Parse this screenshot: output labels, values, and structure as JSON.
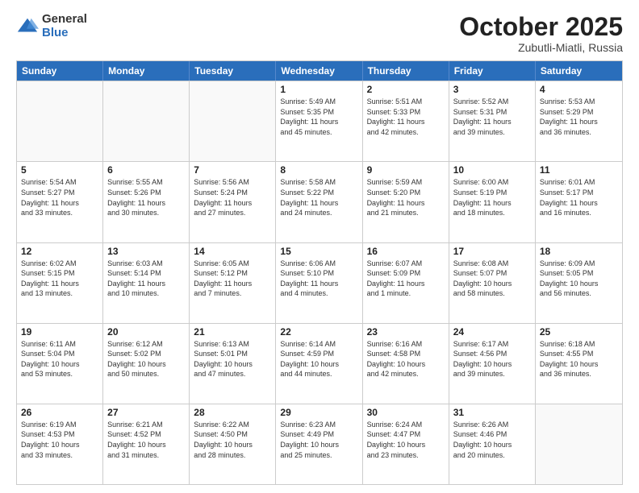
{
  "logo": {
    "general": "General",
    "blue": "Blue"
  },
  "title": "October 2025",
  "location": "Zubutli-Miatli, Russia",
  "weekdays": [
    "Sunday",
    "Monday",
    "Tuesday",
    "Wednesday",
    "Thursday",
    "Friday",
    "Saturday"
  ],
  "rows": [
    [
      {
        "day": "",
        "info": ""
      },
      {
        "day": "",
        "info": ""
      },
      {
        "day": "",
        "info": ""
      },
      {
        "day": "1",
        "info": "Sunrise: 5:49 AM\nSunset: 5:35 PM\nDaylight: 11 hours\nand 45 minutes."
      },
      {
        "day": "2",
        "info": "Sunrise: 5:51 AM\nSunset: 5:33 PM\nDaylight: 11 hours\nand 42 minutes."
      },
      {
        "day": "3",
        "info": "Sunrise: 5:52 AM\nSunset: 5:31 PM\nDaylight: 11 hours\nand 39 minutes."
      },
      {
        "day": "4",
        "info": "Sunrise: 5:53 AM\nSunset: 5:29 PM\nDaylight: 11 hours\nand 36 minutes."
      }
    ],
    [
      {
        "day": "5",
        "info": "Sunrise: 5:54 AM\nSunset: 5:27 PM\nDaylight: 11 hours\nand 33 minutes."
      },
      {
        "day": "6",
        "info": "Sunrise: 5:55 AM\nSunset: 5:26 PM\nDaylight: 11 hours\nand 30 minutes."
      },
      {
        "day": "7",
        "info": "Sunrise: 5:56 AM\nSunset: 5:24 PM\nDaylight: 11 hours\nand 27 minutes."
      },
      {
        "day": "8",
        "info": "Sunrise: 5:58 AM\nSunset: 5:22 PM\nDaylight: 11 hours\nand 24 minutes."
      },
      {
        "day": "9",
        "info": "Sunrise: 5:59 AM\nSunset: 5:20 PM\nDaylight: 11 hours\nand 21 minutes."
      },
      {
        "day": "10",
        "info": "Sunrise: 6:00 AM\nSunset: 5:19 PM\nDaylight: 11 hours\nand 18 minutes."
      },
      {
        "day": "11",
        "info": "Sunrise: 6:01 AM\nSunset: 5:17 PM\nDaylight: 11 hours\nand 16 minutes."
      }
    ],
    [
      {
        "day": "12",
        "info": "Sunrise: 6:02 AM\nSunset: 5:15 PM\nDaylight: 11 hours\nand 13 minutes."
      },
      {
        "day": "13",
        "info": "Sunrise: 6:03 AM\nSunset: 5:14 PM\nDaylight: 11 hours\nand 10 minutes."
      },
      {
        "day": "14",
        "info": "Sunrise: 6:05 AM\nSunset: 5:12 PM\nDaylight: 11 hours\nand 7 minutes."
      },
      {
        "day": "15",
        "info": "Sunrise: 6:06 AM\nSunset: 5:10 PM\nDaylight: 11 hours\nand 4 minutes."
      },
      {
        "day": "16",
        "info": "Sunrise: 6:07 AM\nSunset: 5:09 PM\nDaylight: 11 hours\nand 1 minute."
      },
      {
        "day": "17",
        "info": "Sunrise: 6:08 AM\nSunset: 5:07 PM\nDaylight: 10 hours\nand 58 minutes."
      },
      {
        "day": "18",
        "info": "Sunrise: 6:09 AM\nSunset: 5:05 PM\nDaylight: 10 hours\nand 56 minutes."
      }
    ],
    [
      {
        "day": "19",
        "info": "Sunrise: 6:11 AM\nSunset: 5:04 PM\nDaylight: 10 hours\nand 53 minutes."
      },
      {
        "day": "20",
        "info": "Sunrise: 6:12 AM\nSunset: 5:02 PM\nDaylight: 10 hours\nand 50 minutes."
      },
      {
        "day": "21",
        "info": "Sunrise: 6:13 AM\nSunset: 5:01 PM\nDaylight: 10 hours\nand 47 minutes."
      },
      {
        "day": "22",
        "info": "Sunrise: 6:14 AM\nSunset: 4:59 PM\nDaylight: 10 hours\nand 44 minutes."
      },
      {
        "day": "23",
        "info": "Sunrise: 6:16 AM\nSunset: 4:58 PM\nDaylight: 10 hours\nand 42 minutes."
      },
      {
        "day": "24",
        "info": "Sunrise: 6:17 AM\nSunset: 4:56 PM\nDaylight: 10 hours\nand 39 minutes."
      },
      {
        "day": "25",
        "info": "Sunrise: 6:18 AM\nSunset: 4:55 PM\nDaylight: 10 hours\nand 36 minutes."
      }
    ],
    [
      {
        "day": "26",
        "info": "Sunrise: 6:19 AM\nSunset: 4:53 PM\nDaylight: 10 hours\nand 33 minutes."
      },
      {
        "day": "27",
        "info": "Sunrise: 6:21 AM\nSunset: 4:52 PM\nDaylight: 10 hours\nand 31 minutes."
      },
      {
        "day": "28",
        "info": "Sunrise: 6:22 AM\nSunset: 4:50 PM\nDaylight: 10 hours\nand 28 minutes."
      },
      {
        "day": "29",
        "info": "Sunrise: 6:23 AM\nSunset: 4:49 PM\nDaylight: 10 hours\nand 25 minutes."
      },
      {
        "day": "30",
        "info": "Sunrise: 6:24 AM\nSunset: 4:47 PM\nDaylight: 10 hours\nand 23 minutes."
      },
      {
        "day": "31",
        "info": "Sunrise: 6:26 AM\nSunset: 4:46 PM\nDaylight: 10 hours\nand 20 minutes."
      },
      {
        "day": "",
        "info": ""
      }
    ]
  ]
}
